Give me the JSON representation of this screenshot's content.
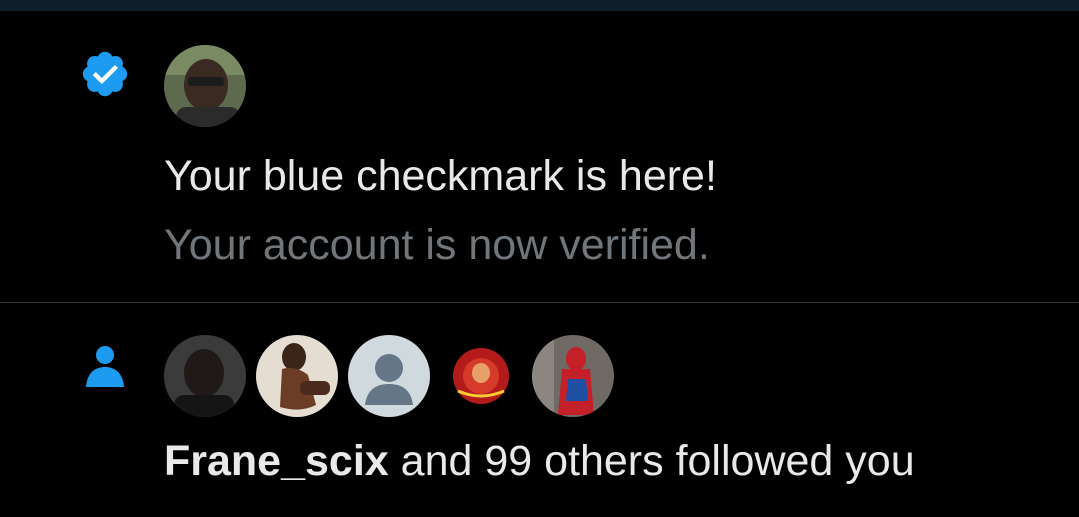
{
  "theme": {
    "background": "#000000",
    "accent": "#1d9bf0",
    "primary_text": "#e7e9ea",
    "secondary_text": "#71767b",
    "divider": "#2f3336"
  },
  "notifications": [
    {
      "type": "verified",
      "icon": "verified-badge-icon",
      "avatar": "user-avatar",
      "title": "Your blue checkmark is here!",
      "subtitle": "Your account is now verified."
    },
    {
      "type": "follow",
      "icon": "person-icon",
      "avatars": [
        "follower-avatar-1",
        "follower-avatar-2",
        "follower-avatar-3-default",
        "follower-avatar-4",
        "follower-avatar-5"
      ],
      "username": "Frane_scix",
      "message": " and 99 others followed you"
    }
  ]
}
